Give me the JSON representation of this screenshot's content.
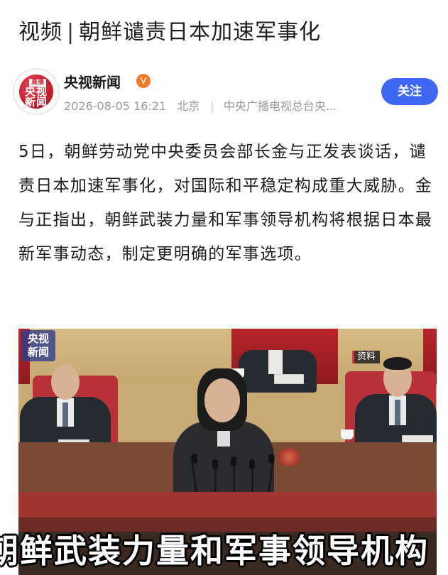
{
  "article": {
    "category": "视频",
    "separator": "|",
    "headline": "朝鲜谴责日本加速军事化"
  },
  "account": {
    "logo_badge": "直播",
    "logo_line1": "央视",
    "logo_line2": "新闻",
    "name": "央视新闻",
    "verified_icon": "verified-badge-icon",
    "verified_glyph": "V",
    "datetime": "2026-08-05 16:21",
    "location": "北京",
    "source": "中央广播电视总台央...",
    "follow_label": "关注",
    "follow_color": "#3f67f3"
  },
  "body_text": "5日，朝鲜劳动党中央委员会部长金与正发表谈话，谴责日本加速军事化，对国际和平稳定构成重大威胁。金与正指出，朝鲜武装力量和军事领导机构将根据日本最新军事动态，制定更明确的军事选项。",
  "video": {
    "watermark_line1": "央视",
    "watermark_line2": "新闻",
    "archive_tag": "资料",
    "subtitle": "朝鲜武装力量和军事领导机构"
  }
}
